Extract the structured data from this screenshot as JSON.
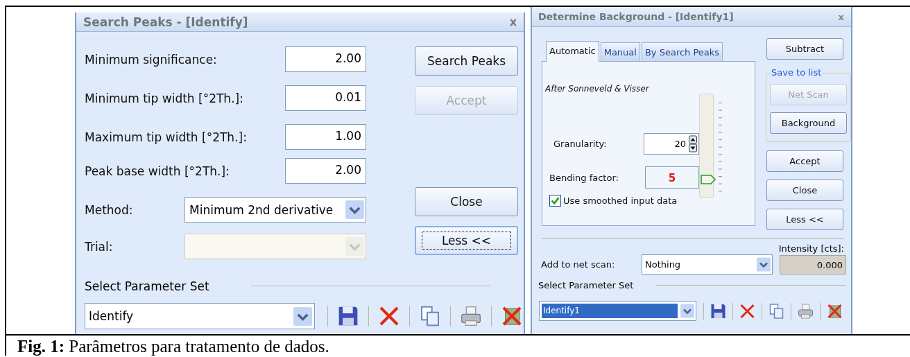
{
  "search_peaks": {
    "title": "Search Peaks - [Identify]",
    "close": "x",
    "fields": [
      {
        "label": "Minimum significance:",
        "value": "2.00"
      },
      {
        "label": "Minimum tip width [°2Th.]:",
        "value": "0.01"
      },
      {
        "label": "Maximum tip width [°2Th.]:",
        "value": "1.00"
      },
      {
        "label": "Peak base width [°2Th.]:",
        "value": "2.00"
      }
    ],
    "dropdowns": [
      {
        "label": "Method:",
        "value": "Minimum 2nd derivative",
        "disabled": false
      },
      {
        "label": "Trial:",
        "disabled": true
      }
    ],
    "buttons": [
      {
        "label": "Search Peaks",
        "disabled": false,
        "focused": false
      },
      {
        "label": "Accept",
        "disabled": true,
        "focused": false
      },
      {
        "label": "Close",
        "disabled": false,
        "focused": false
      },
      {
        "label": "Less <<",
        "disabled": false,
        "focused": true
      }
    ],
    "parameter_set": {
      "heading": "Select Parameter Set",
      "value": "Identify",
      "selected": false
    }
  },
  "determine_background": {
    "title": "Determine Background - [Identify1]",
    "close": "x",
    "tabs": [
      {
        "label": "Automatic",
        "selected": true
      },
      {
        "label": "Manual",
        "selected": false
      },
      {
        "label": "By Search Peaks",
        "selected": false
      }
    ],
    "method_note": "After Sonneveld & Visser",
    "granularity": {
      "label": "Granularity:",
      "value": "20"
    },
    "bending_factor": {
      "label": "Bending factor:",
      "value": "5"
    },
    "slider": {
      "level": 0.12
    },
    "smoothed": {
      "label": "Use smoothed input data",
      "checked": true
    },
    "buttons_top": [
      {
        "label": "Subtract",
        "disabled": false
      }
    ],
    "save_group": {
      "title": "Save to list",
      "buttons": [
        {
          "label": "Net Scan",
          "disabled": true
        },
        {
          "label": "Background",
          "disabled": false
        }
      ]
    },
    "buttons_bottom": [
      {
        "label": "Accept",
        "disabled": false
      },
      {
        "label": "Close",
        "disabled": false
      },
      {
        "label": "Less <<",
        "disabled": false
      }
    ],
    "add_to_net_scan": {
      "label": "Add to net scan:",
      "value": "Nothing"
    },
    "intensity": {
      "label": "Intensity [cts]:",
      "value": "0.000"
    },
    "parameter_set": {
      "heading": "Select Parameter Set",
      "value": "Identify1",
      "selected": true
    }
  },
  "caption": "**Fig. 1:** Parâmetros para tratamento de dados."
}
